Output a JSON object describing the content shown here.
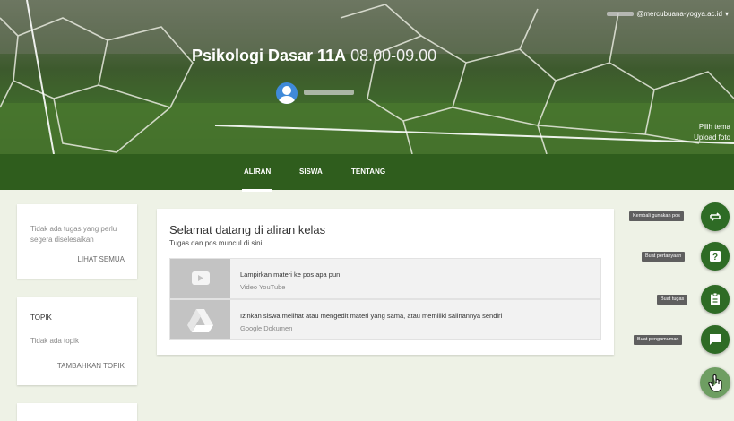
{
  "header": {
    "account_email": "@mercubuana-yogya.ac.id",
    "class_name": "Psikologi Dasar 11A",
    "class_section": "08.00-09.00",
    "theme_link": "Pilih tema",
    "upload_link": "Upload foto"
  },
  "tabs": [
    {
      "label": "ALIRAN",
      "active": true
    },
    {
      "label": "SISWA",
      "active": false
    },
    {
      "label": "TENTANG",
      "active": false
    }
  ],
  "upcoming": {
    "text": "Tidak ada tugas yang perlu segera diselesaikan",
    "link": "LIHAT SEMUA"
  },
  "topics": {
    "heading": "TOPIK",
    "empty": "Tidak ada topik",
    "link": "TAMBAHKAN TOPIK"
  },
  "stream": {
    "title": "Selamat datang di aliran kelas",
    "subtitle": "Tugas dan pos muncul di sini.",
    "items": [
      {
        "title": "Lampirkan materi ke pos apa pun",
        "source": "Video YouTube",
        "icon": "youtube-icon"
      },
      {
        "title": "Izinkan siswa melihat atau mengedit materi yang sama, atau memiliki salinannya sendiri",
        "source": "Google Dokumen",
        "icon": "google-drive-icon"
      }
    ]
  },
  "actions": [
    {
      "label": "Kembali gunakan pos",
      "icon": "reuse-post-icon"
    },
    {
      "label": "Buat pertanyaan",
      "icon": "question-icon"
    },
    {
      "label": "Buat tugas",
      "icon": "assignment-icon"
    },
    {
      "label": "Buat pengumuman",
      "icon": "announcement-icon"
    }
  ],
  "colors": {
    "header_bar": "#2f5d1d",
    "fab": "#2e6b25",
    "background": "#eef2e6"
  }
}
